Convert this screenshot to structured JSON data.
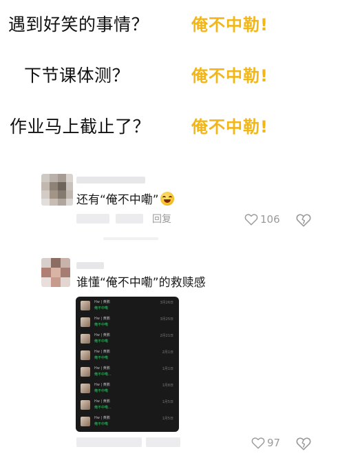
{
  "meme": {
    "answer_color": "#f2b618",
    "rows": [
      {
        "question": "遇到好笑的事情？",
        "answer": "俺不中勒!"
      },
      {
        "question": "下节课体测？",
        "answer": "俺不中勒!"
      },
      {
        "question": "作业马上截止了？",
        "answer": "俺不中勒!"
      }
    ]
  },
  "comments": [
    {
      "text": "还有“俺不中嘞”",
      "emoji": "grinning-sweat-emoji",
      "reply_label": "回复",
      "like_count": "106",
      "icons": [
        "heart-icon",
        "broken-heart-icon"
      ]
    },
    {
      "text": "谁懂“俺不中嘞”的救赎感",
      "like_count": "97",
      "icons": [
        "heart-icon",
        "broken-heart-icon"
      ],
      "attached_screenshot": {
        "theme": "dark",
        "items": [
          {
            "name": "Hw | 黄鹏",
            "message": "俺不中嘞",
            "date": "3月26日"
          },
          {
            "name": "Hw | 黄鹏",
            "message": "俺不中嘞",
            "date": "3月25日"
          },
          {
            "name": "Hw | 黄鹏",
            "message": "俺不中嘞",
            "date": "2月21日"
          },
          {
            "name": "Hw | 黄鹏",
            "message": "俺不中嘞",
            "date": "2月1日"
          },
          {
            "name": "Hw | 黄鹏",
            "message": "俺不中嘞...",
            "date": "1月1日"
          },
          {
            "name": "Hw | 黄鹏",
            "message": "俺不中嘞",
            "date": "1月8日"
          },
          {
            "name": "Hw | 黄鹏",
            "message": "俺不中嘞...",
            "date": "1月5日"
          },
          {
            "name": "Hw | 黄鹏",
            "message": "俺不中嘞",
            "date": "1月5日"
          }
        ]
      }
    }
  ]
}
